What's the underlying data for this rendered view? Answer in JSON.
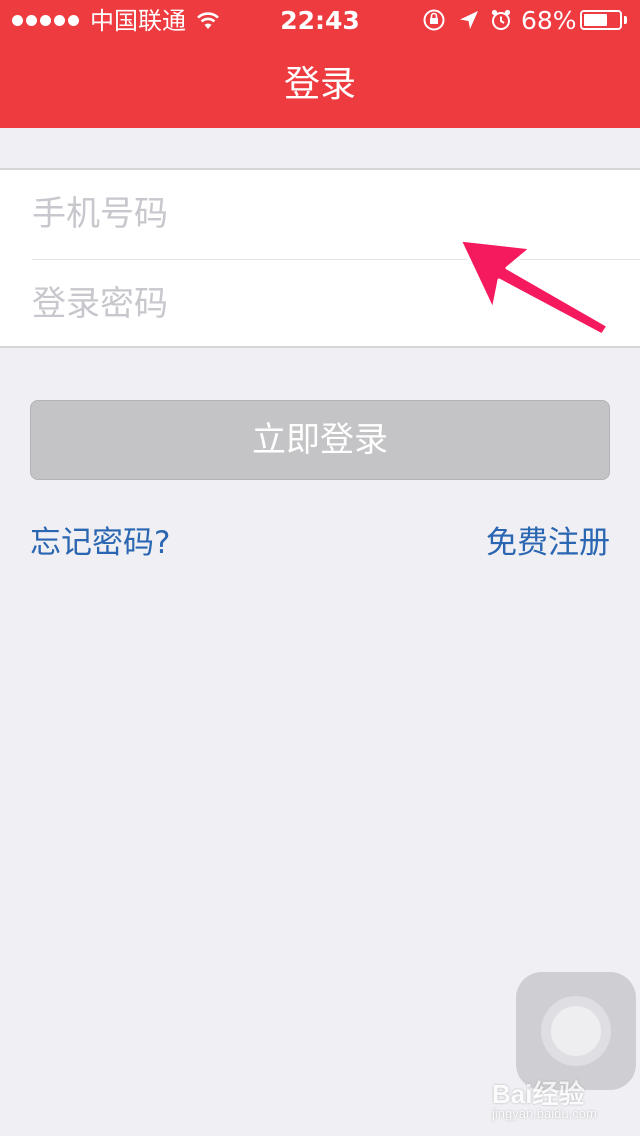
{
  "status_bar": {
    "carrier": "中国联通",
    "time": "22:43",
    "battery_percent": "68%",
    "battery_level": 0.68,
    "icons": [
      "signal-dots-icon",
      "wifi-icon",
      "rotation-lock-icon",
      "location-arrow-icon",
      "alarm-icon",
      "battery-icon"
    ]
  },
  "nav": {
    "title": "登录"
  },
  "form": {
    "phone_placeholder": "手机号码",
    "phone_value": "",
    "password_placeholder": "登录密码",
    "password_value": ""
  },
  "actions": {
    "login_label": "立即登录",
    "forgot_label": "忘记密码?",
    "register_label": "免费注册"
  },
  "watermark": {
    "brand": "Bai经验",
    "url": "jingyan.baidu.com"
  },
  "colors": {
    "nav_background": "#EE3B40",
    "page_background": "#EFEFF4",
    "link": "#2A66B1",
    "button_disabled": "#C4C4C6",
    "annotation_arrow": "#F5195E"
  }
}
